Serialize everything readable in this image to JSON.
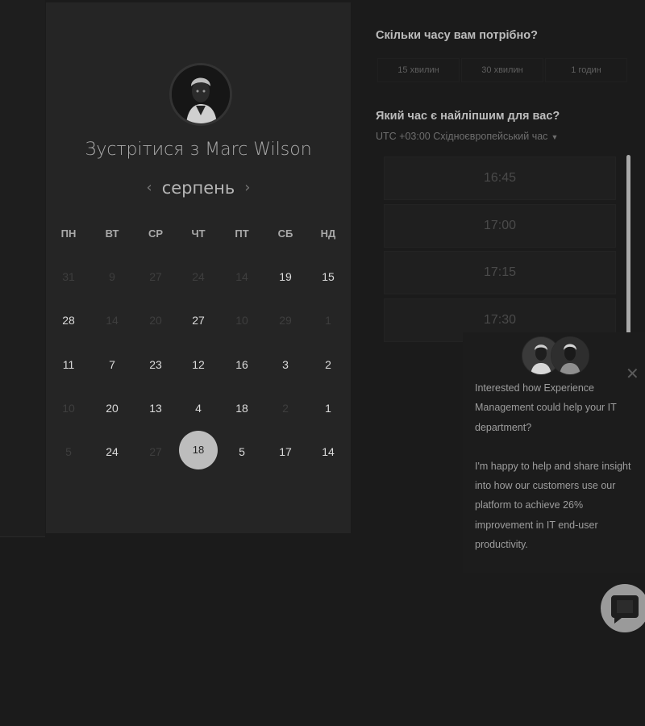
{
  "calendar": {
    "title": "Зустрітися з Marc Wilson",
    "month": "серпень",
    "weekdays": [
      "ПН",
      "ВТ",
      "СР",
      "ЧТ",
      "ПТ",
      "СБ",
      "НД"
    ],
    "weeks": [
      [
        {
          "d": "31",
          "off": true
        },
        {
          "d": "9",
          "off": true
        },
        {
          "d": "27",
          "off": true
        },
        {
          "d": "24",
          "off": true
        },
        {
          "d": "14",
          "off": true
        },
        {
          "d": "19",
          "off": false
        },
        {
          "d": "15",
          "off": false
        }
      ],
      [
        {
          "d": "28",
          "off": false
        },
        {
          "d": "14",
          "off": true
        },
        {
          "d": "20",
          "off": true
        },
        {
          "d": "27",
          "off": false
        },
        {
          "d": "10",
          "off": true
        },
        {
          "d": "29",
          "off": true
        },
        {
          "d": "1",
          "off": true
        }
      ],
      [
        {
          "d": "11",
          "off": false
        },
        {
          "d": "7",
          "off": false
        },
        {
          "d": "23",
          "off": false
        },
        {
          "d": "12",
          "off": false
        },
        {
          "d": "16",
          "off": false
        },
        {
          "d": "3",
          "off": false
        },
        {
          "d": "2",
          "off": false
        }
      ],
      [
        {
          "d": "10",
          "off": true
        },
        {
          "d": "20",
          "off": false
        },
        {
          "d": "13",
          "off": false
        },
        {
          "d": "4",
          "off": false
        },
        {
          "d": "18",
          "off": false
        },
        {
          "d": "2",
          "off": true
        },
        {
          "d": "1",
          "off": false
        }
      ],
      [
        {
          "d": "5",
          "off": true
        },
        {
          "d": "24",
          "off": false
        },
        {
          "d": "27",
          "off": true
        },
        {
          "d": "18",
          "off": false,
          "selected": true
        },
        {
          "d": "5",
          "off": false
        },
        {
          "d": "17",
          "off": false
        },
        {
          "d": "14",
          "off": false
        }
      ]
    ]
  },
  "booking": {
    "duration_question": "Скільки часу вам потрібно?",
    "durations": [
      "15 хвилин",
      "30 хвилин",
      "1 годин"
    ],
    "time_question": "Який час є найліпшим для вас?",
    "timezone": "UTC +03:00 Східноєвропейський час",
    "slots": [
      "16:45",
      "17:00",
      "17:15",
      "17:30"
    ]
  },
  "chat_popup": {
    "paragraph1": "Interested how Experience Management could help your IT department?",
    "paragraph2": "I'm happy to help and share insight into how our customers use our platform to achieve 26% improvement in IT end-user productivity."
  },
  "icons": {
    "prev": "chevron-left-icon",
    "next": "chevron-right-icon",
    "close": "close-icon",
    "chat": "chat-bubble-icon",
    "dropdown": "caret-down-icon"
  },
  "colors": {
    "background": "#1b1b1b",
    "card": "#252525",
    "selected_day": "#bdbdbd",
    "scrollbar": "#a9a9a9"
  }
}
